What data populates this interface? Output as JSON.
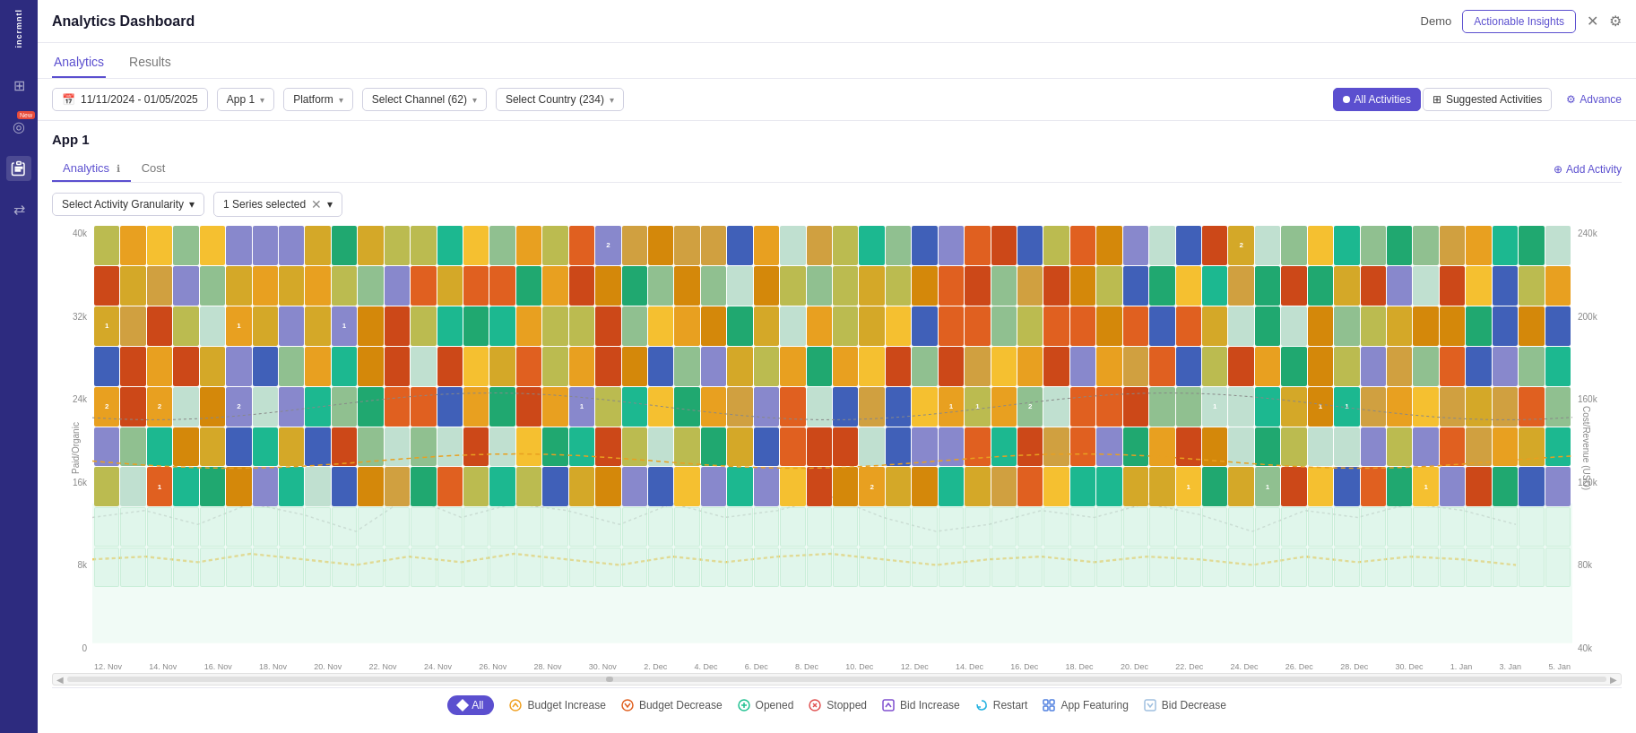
{
  "app": {
    "title": "Analytics Dashboard",
    "logo": "incrmntl"
  },
  "header": {
    "title": "Analytics Dashboard",
    "demo_label": "Demo",
    "actionable_insights_label": "Actionable Insights"
  },
  "nav": {
    "tabs": [
      {
        "label": "Analytics",
        "active": true
      },
      {
        "label": "Results",
        "active": false
      }
    ]
  },
  "filters": {
    "date_range": "11/11/2024 - 01/05/2025",
    "date_icon": "📅",
    "app": "App 1",
    "platform": "Platform",
    "channel": "Select Channel (62)",
    "country": "Select Country (234)",
    "all_activities_label": "All Activities",
    "suggested_activities_label": "Suggested Activities",
    "advance_label": "Advance"
  },
  "content": {
    "app_title": "App 1",
    "sub_tabs": [
      {
        "label": "Analytics",
        "active": true
      },
      {
        "label": "Cost",
        "active": false
      }
    ],
    "add_activity_label": "Add Activity",
    "chart_controls": {
      "granularity_placeholder": "Select Activity Granularity",
      "series_selected": "1 Series selected"
    }
  },
  "chart": {
    "y_axis_label": "Paid/Organic",
    "y_axis_right_label": "Cost/Revenue (USD)",
    "y_left": [
      "40k",
      "32k",
      "24k",
      "16k",
      "8k",
      "0"
    ],
    "y_right": [
      "240k",
      "200k",
      "160k",
      "120k",
      "80k",
      "40k"
    ],
    "x_labels": [
      "12. Nov",
      "14. Nov",
      "16. Nov",
      "18. Nov",
      "20. Nov",
      "22. Nov",
      "24. Nov",
      "26. Nov",
      "28. Nov",
      "30. Nov",
      "2. Dec",
      "4. Dec",
      "6. Dec",
      "8. Dec",
      "10. Dec",
      "12. Dec",
      "14. Dec",
      "16. Dec",
      "18. Dec",
      "20. Dec",
      "22. Dec",
      "24. Dec",
      "26. Dec",
      "28. Dec",
      "30. Dec",
      "1. Jan",
      "3. Jan",
      "5. Jan"
    ]
  },
  "legend": {
    "all_label": "All",
    "items": [
      {
        "label": "Budget Increase",
        "color": "#f0a020",
        "icon": "budget-increase-icon"
      },
      {
        "label": "Budget Decrease",
        "color": "#e06020",
        "icon": "budget-decrease-icon"
      },
      {
        "label": "Opened",
        "color": "#20c090",
        "icon": "opened-icon"
      },
      {
        "label": "Stopped",
        "color": "#e05050",
        "icon": "stopped-icon"
      },
      {
        "label": "Bid Increase",
        "color": "#8050d0",
        "icon": "bid-increase-icon"
      },
      {
        "label": "Restart",
        "color": "#20b0e0",
        "icon": "restart-icon"
      },
      {
        "label": "App Featuring",
        "color": "#5080e0",
        "icon": "app-featuring-icon"
      },
      {
        "label": "Bid Decrease",
        "color": "#a0c0e0",
        "icon": "bid-decrease-icon"
      }
    ]
  },
  "sidebar": {
    "icons": [
      {
        "name": "grid-icon",
        "symbol": "⊞",
        "active": false
      },
      {
        "name": "activity-icon",
        "symbol": "◎",
        "active": false,
        "badge": "New"
      },
      {
        "name": "clipboard-icon",
        "symbol": "📋",
        "active": true
      },
      {
        "name": "exchange-icon",
        "symbol": "⇄",
        "active": false
      }
    ]
  }
}
